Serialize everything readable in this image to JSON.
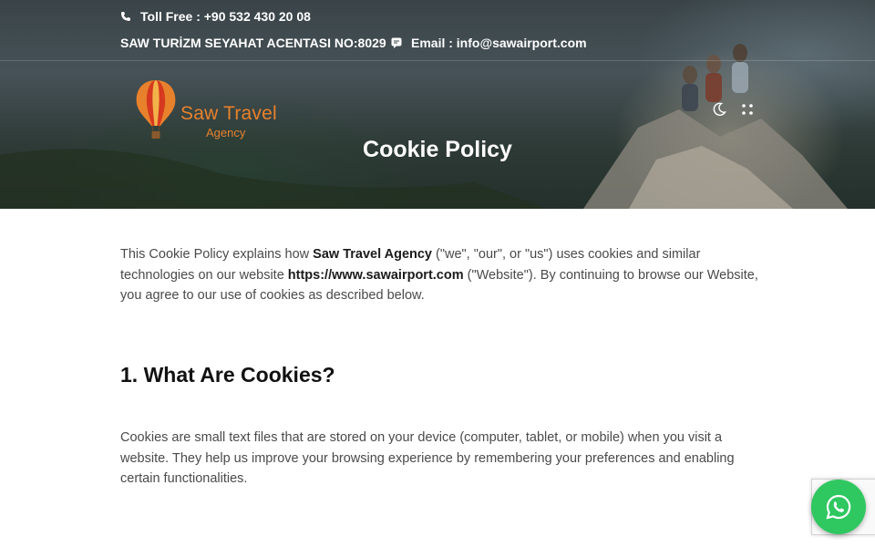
{
  "topbar": {
    "phone_text": "Toll Free : +90 532 430 20 08",
    "registration_text": "SAW TURİZM SEYAHAT ACENTASI NO:8029",
    "email_text": "Email : info@sawairport.com",
    "phone_icon": "phone-icon",
    "email_icon": "chat-icon"
  },
  "logo": {
    "brand": "Saw Travel",
    "sub": "Agency",
    "icon": "hot-air-balloon-icon"
  },
  "header_icons": {
    "theme_icon": "moon-icon",
    "menu_icon": "grid-dots-icon"
  },
  "hero": {
    "title": "Cookie Policy"
  },
  "content": {
    "intro_1": "This Cookie Policy explains how ",
    "intro_brand": "Saw Travel Agency",
    "intro_2": " (\"we\", \"our\", or \"us\") uses cookies and similar technologies on our website ",
    "intro_url": "https://www.sawairport.com",
    "intro_3": " (\"Website\"). By continuing to browse our Website, you agree to our use of cookies as described below.",
    "section1_heading": "1. What Are Cookies?",
    "section1_body": "Cookies are small text files that are stored on your device (computer, tablet, or mobile) when you visit a website. They help us improve your browsing experience by remembering your preferences and enabling certain functionalities."
  },
  "floating": {
    "whatsapp_icon": "whatsapp-icon",
    "recaptcha_icon": "recaptcha-badge"
  },
  "colors": {
    "brand_orange": "#e8812c",
    "whatsapp_green": "#2fc760"
  }
}
